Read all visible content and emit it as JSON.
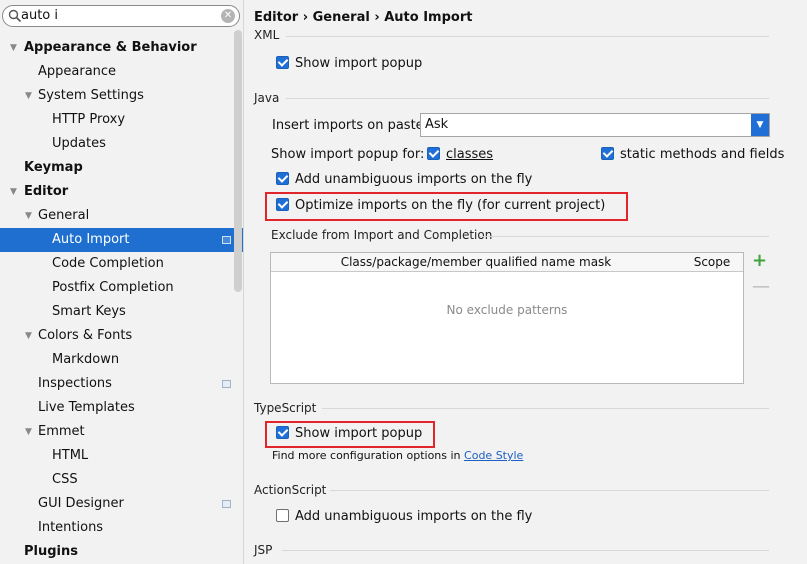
{
  "search": {
    "value": "auto i"
  },
  "tree": [
    {
      "label": "Appearance & Behavior",
      "indent": 0,
      "arrow": true,
      "bold": true
    },
    {
      "label": "Appearance",
      "indent": 1,
      "arrow": false
    },
    {
      "label": "System Settings",
      "indent": 1,
      "arrow": true
    },
    {
      "label": "HTTP Proxy",
      "indent": 2,
      "arrow": false
    },
    {
      "label": "Updates",
      "indent": 2,
      "arrow": false
    },
    {
      "label": "Keymap",
      "indent": 0,
      "arrow": false,
      "bold": true
    },
    {
      "label": "Editor",
      "indent": 0,
      "arrow": true,
      "bold": true
    },
    {
      "label": "General",
      "indent": 1,
      "arrow": true
    },
    {
      "label": "Auto Import",
      "indent": 2,
      "arrow": false,
      "selected": true,
      "badge": true
    },
    {
      "label": "Code Completion",
      "indent": 2,
      "arrow": false
    },
    {
      "label": "Postfix Completion",
      "indent": 2,
      "arrow": false
    },
    {
      "label": "Smart Keys",
      "indent": 2,
      "arrow": false
    },
    {
      "label": "Colors & Fonts",
      "indent": 1,
      "arrow": true
    },
    {
      "label": "Markdown",
      "indent": 2,
      "arrow": false
    },
    {
      "label": "Inspections",
      "indent": 1,
      "arrow": false,
      "badge": true
    },
    {
      "label": "Live Templates",
      "indent": 1,
      "arrow": false
    },
    {
      "label": "Emmet",
      "indent": 1,
      "arrow": true
    },
    {
      "label": "HTML",
      "indent": 2,
      "arrow": false
    },
    {
      "label": "CSS",
      "indent": 2,
      "arrow": false
    },
    {
      "label": "GUI Designer",
      "indent": 1,
      "arrow": false,
      "badge": true
    },
    {
      "label": "Intentions",
      "indent": 1,
      "arrow": false
    },
    {
      "label": "Plugins",
      "indent": 0,
      "arrow": false,
      "bold": true
    }
  ],
  "breadcrumb": "Editor › General › Auto Import",
  "xml": {
    "title": "XML",
    "show_import_popup": {
      "label": "Show import popup",
      "checked": true
    }
  },
  "java": {
    "title": "Java",
    "insert_label": "Insert imports on paste:",
    "insert_value": "Ask",
    "popup_for_label": "Show import popup for:",
    "classes": {
      "label": "classes",
      "checked": true
    },
    "static_methods": {
      "label": "static methods and fields",
      "checked": true
    },
    "add_unambiguous": {
      "label": "Add unambiguous imports on the fly",
      "checked": true
    },
    "optimize": {
      "label": "Optimize imports on the fly (for current project)",
      "checked": true
    },
    "exclude_title": "Exclude from Import and Completion",
    "table_col1": "Class/package/member qualified name mask",
    "table_col2": "Scope",
    "table_empty": "No exclude patterns"
  },
  "typescript": {
    "title": "TypeScript",
    "show_import_popup": {
      "label": "Show import popup",
      "checked": true
    },
    "hint_prefix": "Find more configuration options in",
    "hint_link": "Code Style"
  },
  "actionscript": {
    "title": "ActionScript",
    "add_unambiguous": {
      "label": "Add unambiguous imports on the fly",
      "checked": false
    }
  },
  "jsp": {
    "title": "JSP"
  },
  "colors": {
    "accent": "#1f6fd6",
    "selection": "#1e6fd0",
    "highlight": "#e0262a",
    "add": "#3fa33f"
  }
}
